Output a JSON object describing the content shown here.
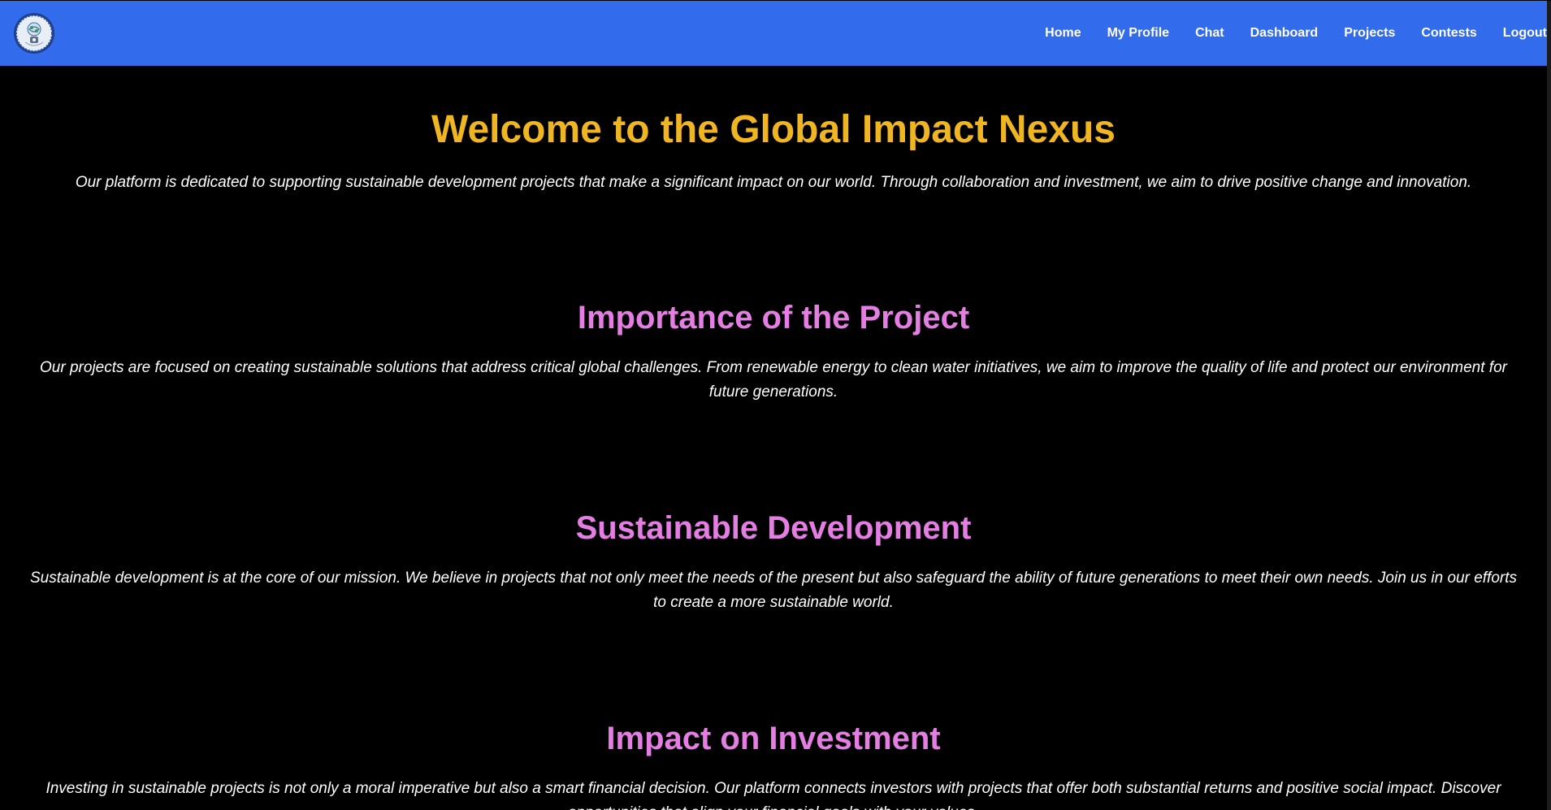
{
  "nav": {
    "logo_icon": "globe-seal-logo-icon",
    "links": [
      "Home",
      "My Profile",
      "Chat",
      "Dashboard",
      "Projects",
      "Contests",
      "Logout"
    ]
  },
  "hero": {
    "title": "Welcome to the Global Impact Nexus",
    "text": "Our platform is dedicated to supporting sustainable development projects that make a significant impact on our world. Through collaboration and investment, we aim to drive positive change and innovation."
  },
  "sections": [
    {
      "title": "Importance of the Project",
      "text": "Our projects are focused on creating sustainable solutions that address critical global challenges. From renewable energy to clean water initiatives, we aim to improve the quality of life and protect our environment for future generations."
    },
    {
      "title": "Sustainable Development",
      "text": "Sustainable development is at the core of our mission. We believe in projects that not only meet the needs of the present but also safeguard the ability of future generations to meet their own needs. Join us in our efforts to create a more sustainable world."
    },
    {
      "title": "Impact on Investment",
      "text": "Investing in sustainable projects is not only a moral imperative but also a smart financial decision. Our platform connects investors with projects that offer both substantial returns and positive social impact. Discover opportunities that align your financial goals with your values."
    }
  ],
  "colors": {
    "navbar": "#326beb",
    "background": "#000000",
    "hero_title": "#f0b622",
    "section_title": "#e57ee3",
    "body_text": "#ffffff"
  }
}
